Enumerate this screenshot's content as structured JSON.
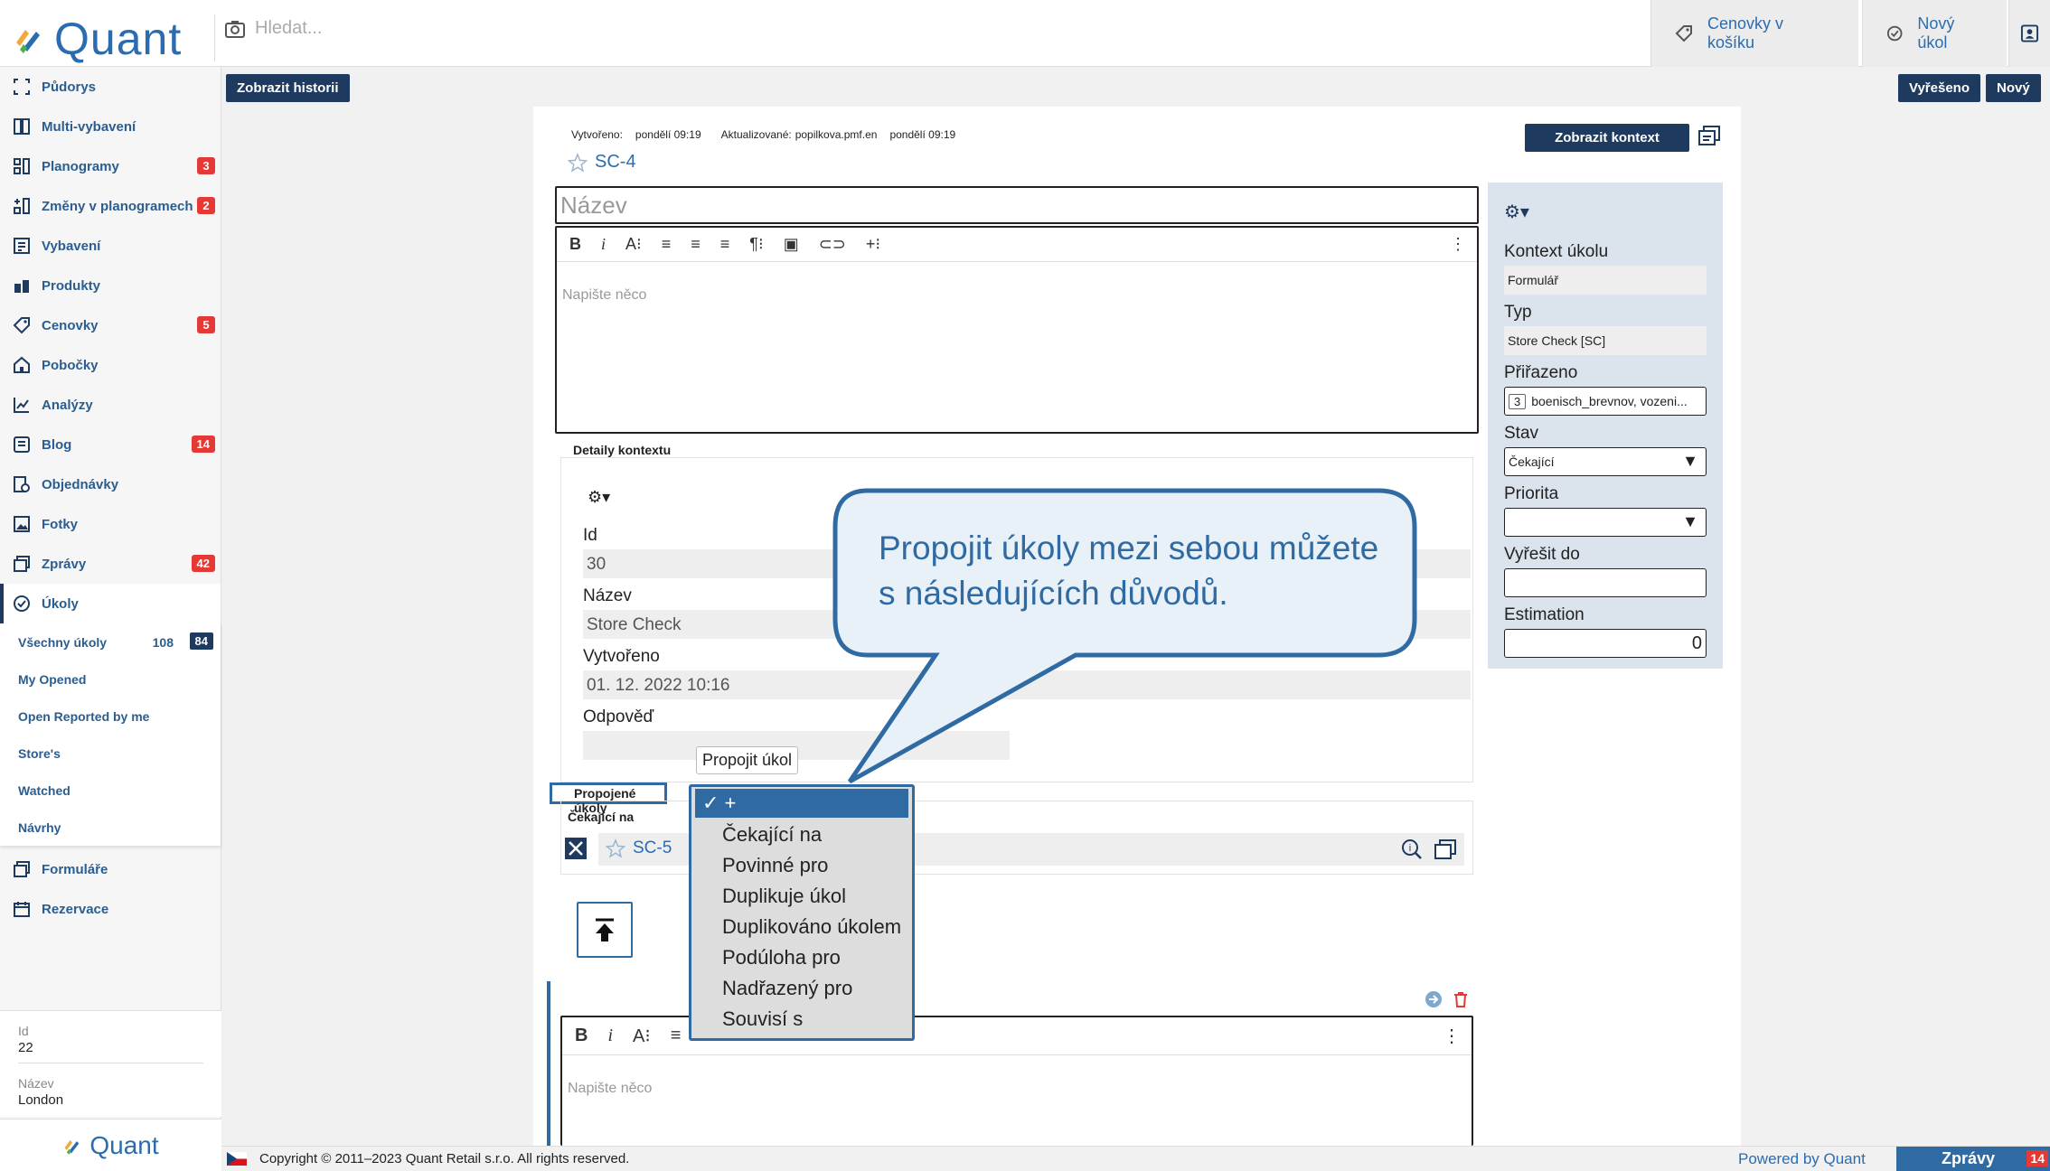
{
  "app": {
    "name": "Quant"
  },
  "header": {
    "search_placeholder": "Hledat...",
    "cart_label": "Cenovky v košíku",
    "new_task_label": "Nový úkol"
  },
  "sidebar": {
    "items": [
      {
        "label": "Půdorys",
        "icon": "floorplan-icon"
      },
      {
        "label": "Multi-vybavení",
        "icon": "multi-equipment-icon"
      },
      {
        "label": "Planogramy",
        "icon": "planogram-icon",
        "badge": "3"
      },
      {
        "label": "Změny v planogramech",
        "icon": "planogram-changes-icon",
        "badge": "2"
      },
      {
        "label": "Vybavení",
        "icon": "equipment-icon"
      },
      {
        "label": "Produkty",
        "icon": "products-icon"
      },
      {
        "label": "Cenovky",
        "icon": "price-tag-icon",
        "badge": "5"
      },
      {
        "label": "Pobočky",
        "icon": "store-icon"
      },
      {
        "label": "Analýzy",
        "icon": "analytics-icon"
      },
      {
        "label": "Blog",
        "icon": "blog-icon",
        "badge": "14"
      },
      {
        "label": "Objednávky",
        "icon": "orders-icon"
      },
      {
        "label": "Fotky",
        "icon": "photos-icon"
      },
      {
        "label": "Zprávy",
        "icon": "messages-icon",
        "badge": "42"
      },
      {
        "label": "Úkoly",
        "icon": "tasks-icon"
      }
    ],
    "subitems": [
      {
        "label": "Všechny úkoly",
        "count": "108",
        "badge": "84"
      },
      {
        "label": "My Opened"
      },
      {
        "label": "Open Reported by me"
      },
      {
        "label": "Store's"
      },
      {
        "label": "Watched"
      },
      {
        "label": "Návrhy"
      }
    ],
    "bottom_items": [
      {
        "label": "Formuláře",
        "icon": "forms-icon"
      },
      {
        "label": "Rezervace",
        "icon": "calendar-icon"
      }
    ],
    "info": {
      "id_label": "Id",
      "id_value": "22",
      "name_label": "Název",
      "name_value": "London"
    }
  },
  "toolbar": {
    "history_label": "Zobrazit historii",
    "resolved_label": "Vyřešeno",
    "new_label": "Nový"
  },
  "task": {
    "created_label": "Vytvořeno:",
    "created_value": "pondělí 09:19",
    "updated_label": "Aktualizované:",
    "updated_by": "popilkova.pmf.en",
    "updated_value": "pondělí 09:19",
    "code": "SC-4",
    "title_placeholder": "Název",
    "body_placeholder": "Napište něco",
    "show_context_label": "Zobrazit kontext"
  },
  "context": {
    "section_label": "Detaily kontextu",
    "id_label": "Id",
    "id_value": "30",
    "name_label": "Název",
    "name_value": "Store Check",
    "created_label": "Vytvořeno",
    "created_value": "01. 12. 2022 10:16",
    "answer_label": "Odpověď"
  },
  "linked": {
    "section_label": "Propojené úkoly",
    "tooltip": "Propojit úkol",
    "group_label": "Čekající na",
    "task_code": "SC-5"
  },
  "dropdown": {
    "options": [
      "+",
      "Čekající na",
      "Povinné pro",
      "Duplikuje úkol",
      "Duplikováno úkolem",
      "Podúloha pro",
      "Nadřazený pro",
      "Souvisí s"
    ]
  },
  "callout": {
    "text": "Propojit úkoly mezi sebou můžete s následujících důvodů."
  },
  "properties": {
    "context_label": "Kontext úkolu",
    "context_value": "Formulář",
    "type_label": "Typ",
    "type_value": "Store Check [SC]",
    "assigned_label": "Přiřazeno",
    "assigned_count": "3",
    "assigned_value": "boenisch_brevnov, vozeni...",
    "state_label": "Stav",
    "state_value": "Čekající",
    "priority_label": "Priorita",
    "priority_value": "",
    "due_label": "Vyřešit do",
    "due_value": "",
    "estimation_label": "Estimation",
    "estimation_value": "0"
  },
  "footer": {
    "copyright": "Copyright © 2011–2023 Quant Retail s.r.o. All rights reserved.",
    "powered": "Powered by Quant",
    "messages_label": "Zprávy",
    "messages_badge": "14"
  },
  "colors": {
    "brand": "#2b6cb0",
    "dark": "#1e3a5f",
    "badge": "#e53935",
    "callout_bg": "#e8f0f8",
    "callout_border": "#2f6aa3"
  }
}
